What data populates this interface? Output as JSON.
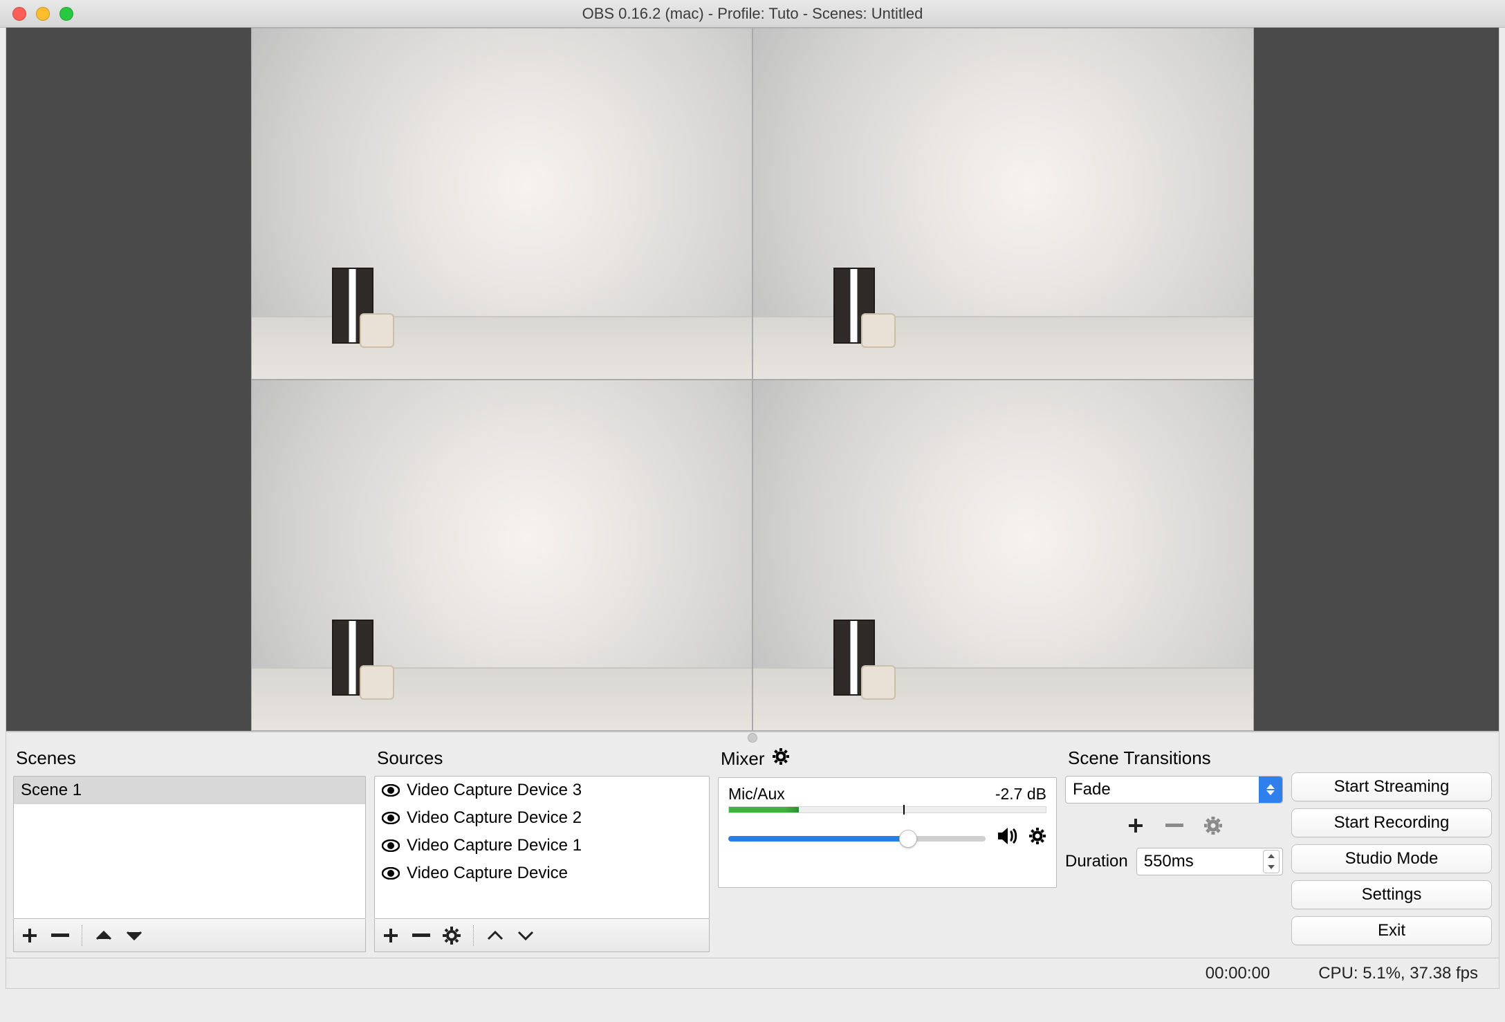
{
  "window": {
    "title": "OBS 0.16.2 (mac) - Profile: Tuto - Scenes: Untitled"
  },
  "scenes": {
    "header": "Scenes",
    "items": [
      {
        "label": "Scene 1",
        "selected": true
      }
    ]
  },
  "sources": {
    "header": "Sources",
    "items": [
      {
        "label": "Video Capture Device 3",
        "visible": true
      },
      {
        "label": "Video Capture Device 2",
        "visible": true
      },
      {
        "label": "Video Capture Device 1",
        "visible": true
      },
      {
        "label": "Video Capture Device",
        "visible": true
      }
    ]
  },
  "mixer": {
    "header": "Mixer",
    "channel": {
      "name": "Mic/Aux",
      "level": "-2.7 dB"
    }
  },
  "transitions": {
    "header": "Scene Transitions",
    "selected": "Fade",
    "duration_label": "Duration",
    "duration_value": "550ms"
  },
  "buttons": {
    "start_streaming": "Start Streaming",
    "start_recording": "Start Recording",
    "studio_mode": "Studio Mode",
    "settings": "Settings",
    "exit": "Exit"
  },
  "status": {
    "time": "00:00:00",
    "cpu": "CPU: 5.1%, 37.38 fps"
  }
}
